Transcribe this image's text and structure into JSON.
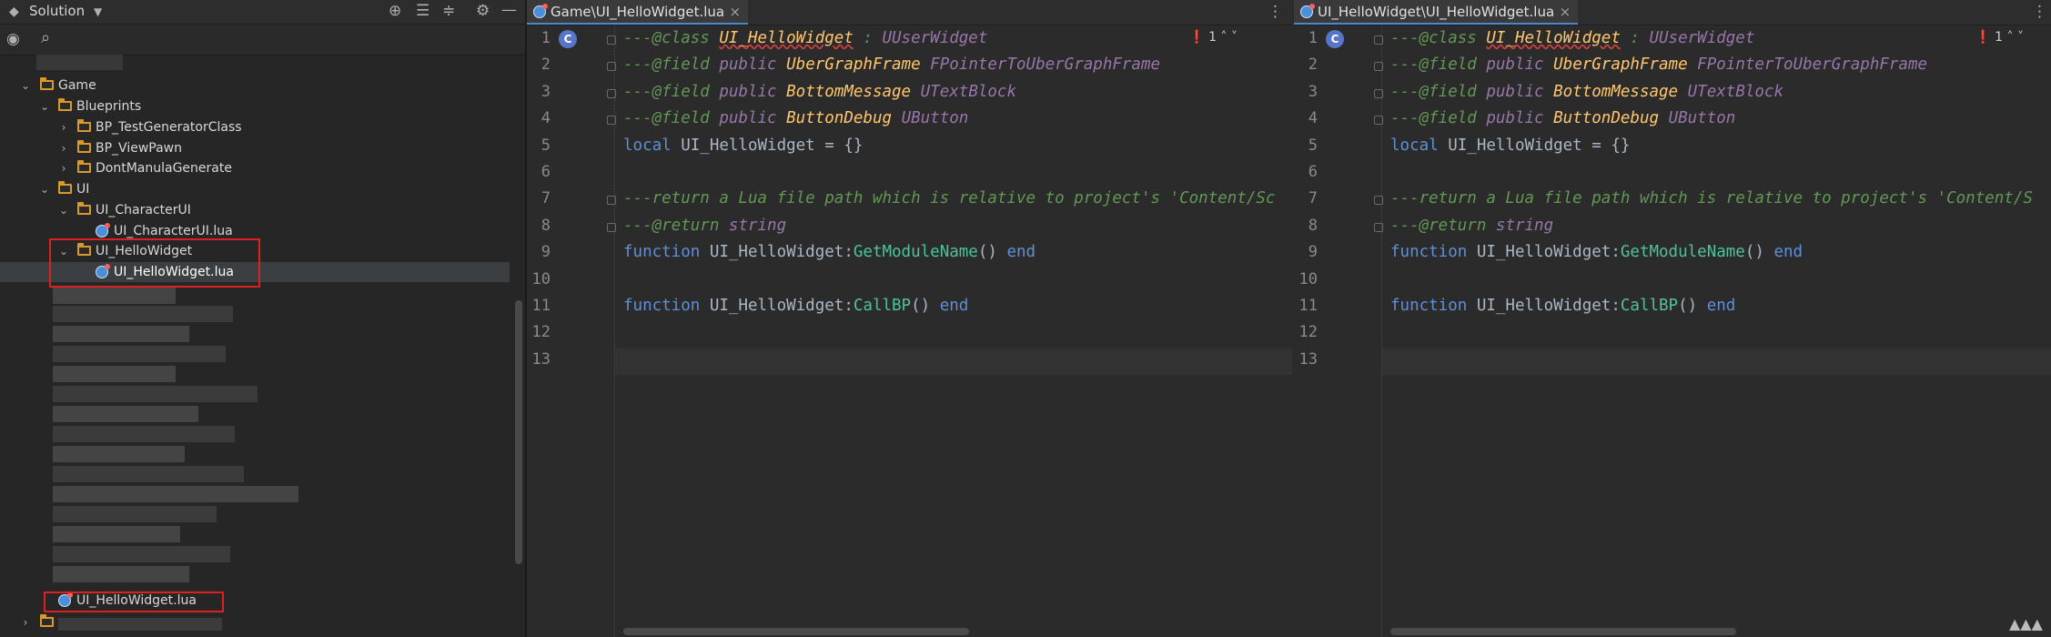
{
  "left": {
    "toolbar_title": "Solution",
    "icons": [
      "locate-icon",
      "expand-all-icon",
      "collapse-all-icon",
      "settings-icon",
      "minimize-icon"
    ],
    "tree": [
      {
        "label": "Game",
        "type": "folder",
        "expanded": true
      },
      {
        "label": "Blueprints",
        "type": "folder",
        "expanded": true
      },
      {
        "label": "BP_TestGeneratorClass",
        "type": "folder",
        "expanded": false
      },
      {
        "label": "BP_ViewPawn",
        "type": "folder",
        "expanded": false
      },
      {
        "label": "DontManulaGenerate",
        "type": "folder",
        "expanded": false
      },
      {
        "label": "UI",
        "type": "folder",
        "expanded": true
      },
      {
        "label": "UI_CharacterUI",
        "type": "folder",
        "expanded": true
      },
      {
        "label": "UI_CharacterUI.lua",
        "type": "lua"
      },
      {
        "label": "UI_HelloWidget",
        "type": "folder",
        "expanded": true
      },
      {
        "label": "UI_HelloWidget.lua",
        "type": "lua",
        "selected": true
      }
    ],
    "bottom_item": "UI_HelloWidget.lua"
  },
  "editor_left": {
    "tab_label": "Game\\UI_HelloWidget.lua",
    "error_count": "1",
    "class_badge": "C"
  },
  "editor_right": {
    "tab_label": "UI_HelloWidget\\UI_HelloWidget.lua",
    "error_count": "1",
    "class_badge": "C"
  },
  "line_numbers": [
    "1",
    "2",
    "3",
    "4",
    "5",
    "6",
    "7",
    "8",
    "9",
    "10",
    "11",
    "12",
    "13"
  ],
  "code": {
    "l1": {
      "prefix": "---@class ",
      "cls": "UI_HelloWidget",
      "sep": " : ",
      "base": "UUserWidget"
    },
    "l2": {
      "prefix": "---@field ",
      "kw": "public ",
      "type": "UberGraphFrame ",
      "name": "FPointerToUberGraphFrame"
    },
    "l3": {
      "prefix": "---@field ",
      "kw": "public ",
      "type": "BottomMessage ",
      "name": "UTextBlock"
    },
    "l4": {
      "prefix": "---@field ",
      "kw": "public ",
      "type": "ButtonDebug ",
      "name": "UButton"
    },
    "l5": {
      "kw": "local ",
      "rest": "UI_HelloWidget = {}"
    },
    "l7": "---return a Lua file path which is relative to project's 'Content/Sc",
    "l7r": "---return a Lua file path which is relative to project's 'Content/S",
    "l8": {
      "prefix": "---@return ",
      "type": "string"
    },
    "l9": {
      "kw": "function ",
      "obj": "UI_HelloWidget:",
      "fn": "GetModuleName",
      "tail": "() ",
      "end": "end"
    },
    "l11": {
      "kw": "function ",
      "obj": "UI_HelloWidget:",
      "fn": "CallBP",
      "tail": "() ",
      "end": "end"
    }
  },
  "status_icon": "inspector-icon"
}
